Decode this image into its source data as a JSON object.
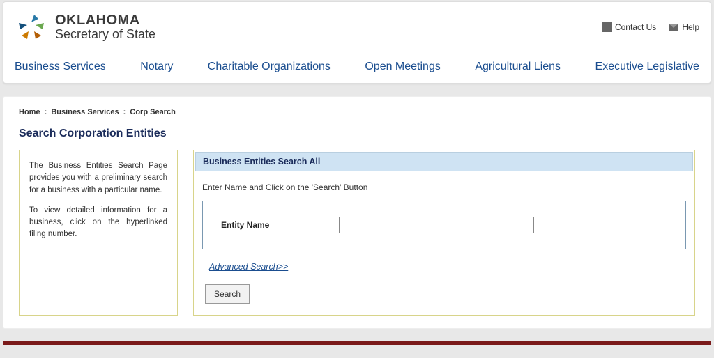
{
  "brand": {
    "line1": "OKLAHOMA",
    "line2": "Secretary of State"
  },
  "header_links": {
    "contact": "Contact Us",
    "help": "Help"
  },
  "nav": [
    "Business Services",
    "Notary",
    "Charitable Organizations",
    "Open Meetings",
    "Agricultural Liens",
    "Executive Legislative"
  ],
  "breadcrumb": {
    "home": "Home",
    "bs": "Business Services",
    "current": "Corp Search"
  },
  "page_title": "Search Corporation Entities",
  "info": {
    "p1": "The Business Entities Search Page provides you with a preliminary search for a business with a particular name.",
    "p2": "To view detailed information for a business, click on the hyperlinked filing number."
  },
  "panel": {
    "header": "Business Entities Search All",
    "instruction": "Enter Name and Click on the 'Search' Button",
    "field_label": "Entity Name",
    "entity_value": "",
    "advanced": "Advanced Search>>",
    "search_btn": "Search"
  }
}
